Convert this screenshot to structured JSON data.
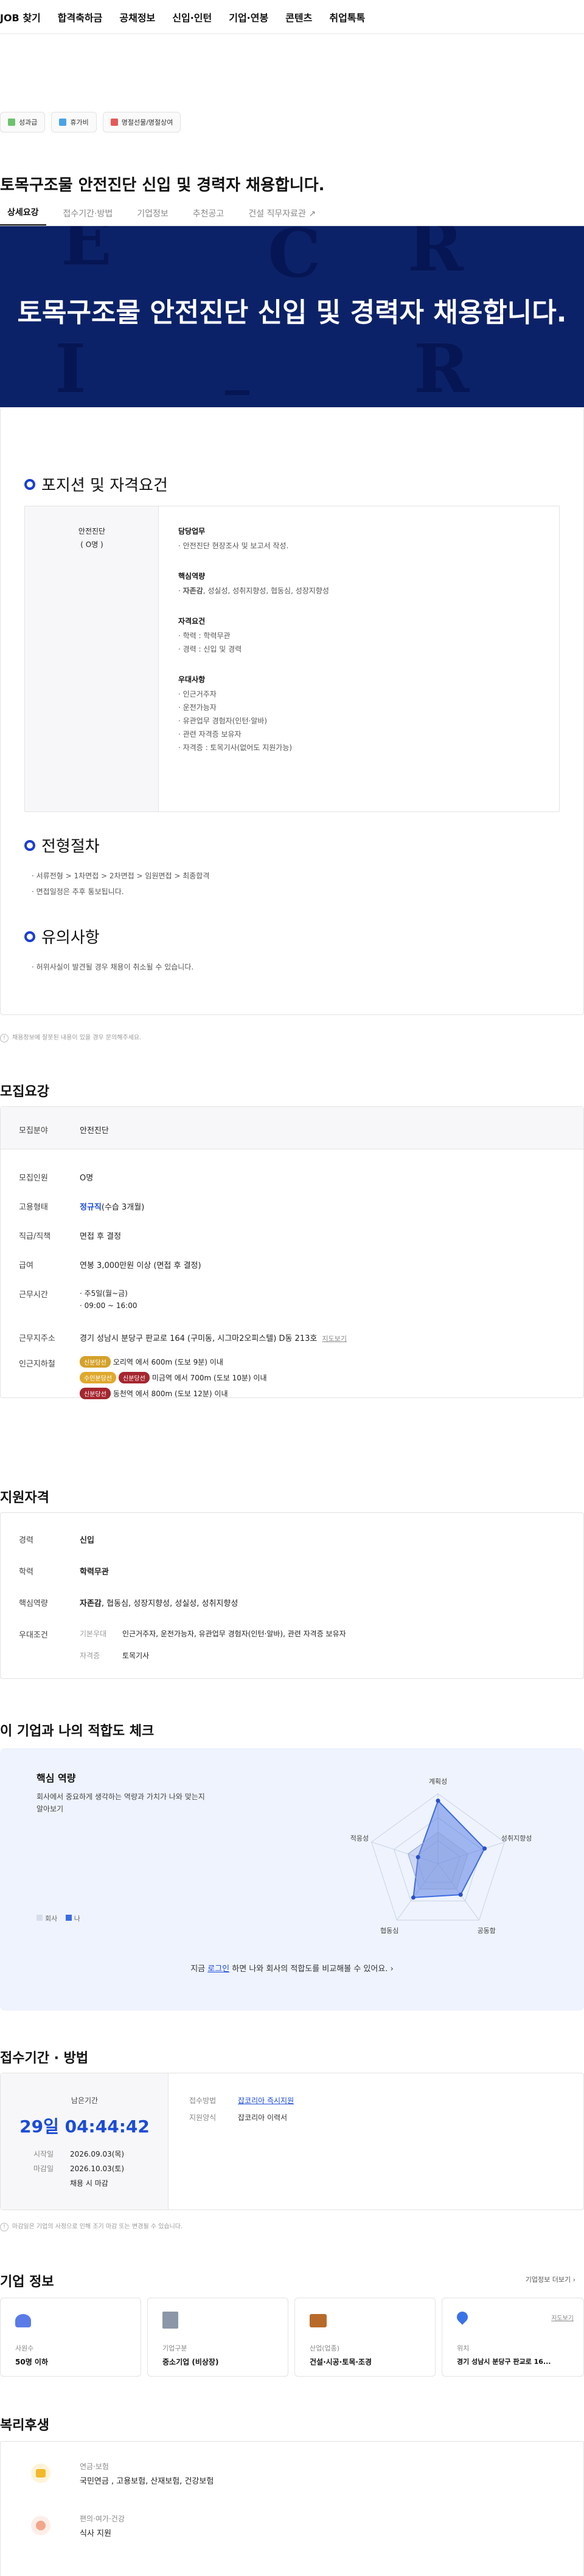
{
  "nav": [
    "JOB 찾기",
    "합격축하금",
    "공채정보",
    "신입·인턴",
    "기업·연봉",
    "콘텐츠",
    "취업톡톡"
  ],
  "badges": [
    "성과급",
    "휴가비",
    "명절선물/명절상여"
  ],
  "title": "토목구조물 안전진단 신입 및 경력자 채용합니다.",
  "tabs": [
    "상세요강",
    "접수기간·방법",
    "기업정보",
    "추천공고",
    "건설 직무자료관"
  ],
  "hero": {
    "title": "토목구조물 안전진단 신입 및 경력자 채용합니다.",
    "letters": [
      "E",
      "C",
      "R",
      "I",
      "U",
      "R"
    ]
  },
  "position": {
    "heading": "포지션 및 자격요건",
    "job_title": "안전진단",
    "headcount": "( O명 )",
    "duty_label": "담당업무",
    "duty": "· 안전진단 현장조사 및 보고서 작성.",
    "core_label": "핵심역량",
    "core_prefix": "· ",
    "core_bold": "자존감",
    "core_rest": ", 성실성, 성취지향성, 협동심, 성장지향성",
    "qual_label": "자격요건",
    "quals": [
      "· 학력 : 학력무관",
      "· 경력 : 신입 및 경력"
    ],
    "pref_label": "우대사항",
    "prefs": [
      "· 인근거주자",
      "· 운전가능자",
      "· 유관업무 경험자(인턴·알바)",
      "· 관련 자격증 보유자",
      "· 자격증 : 토목기사(없어도 지원가능)"
    ]
  },
  "process": {
    "heading": "전형절차",
    "steps": "· 서류전형 > 1차면접 > 2차면접 > 임원면접 > 최종합격",
    "note": "· 면접일정은 추후 통보됩니다."
  },
  "caution": {
    "heading": "유의사항",
    "text": "· 허위사실이 발견될 경우 채용이 취소될 수 있습니다."
  },
  "notice1": "채용정보에 잘못된 내용이 있을 경우 문의해주세요.",
  "summary": {
    "heading": "모집요강",
    "rows": [
      {
        "label": "모집분야",
        "value": "안전진단"
      },
      {
        "label": "모집인원",
        "value": "O명"
      },
      {
        "label": "고용형태",
        "value": "정규직",
        "extra": "(수습 3개월)"
      },
      {
        "label": "직급/직책",
        "value": "면접 후 결정"
      },
      {
        "label": "급여",
        "value": "연봉 3,000만원 이상 (면접 후 결정)"
      },
      {
        "label": "근무시간",
        "value": "· 주5일(월~금)",
        "value2": "· 09:00 ~ 16:00"
      },
      {
        "label": "근무지주소",
        "value": "경기 성남시 분당구 판교로 164 (구미동, 시그마2오피스텔) D동 213호",
        "link": "지도보기"
      },
      {
        "label": "인근지하철"
      }
    ],
    "subway": [
      {
        "line": "신분당선",
        "color": "#d4a12a",
        "text": "오리역 에서 600m (도보 9분) 이내"
      },
      {
        "line": "수인분당선",
        "color": "#e0a92d",
        "line2": "신분당선",
        "color2": "#a5262f",
        "text": "미금역 에서 700m (도보 10분) 이내"
      },
      {
        "line": "신분당선",
        "color": "#a5262f",
        "text": "동천역 에서 800m (도보 12분) 이내"
      }
    ]
  },
  "eligibility": {
    "heading": "지원자격",
    "career_label": "경력",
    "career": "신입",
    "edu_label": "학력",
    "edu": "학력무관",
    "core_label": "핵심역량",
    "core_bold": "자존감",
    "core_rest": ", 협동심, 성장지향성, 성실성, 성취지향성",
    "pref_label": "우대조건",
    "basic_label": "기본우대",
    "basic": "인근거주자, 운전가능자, 유관업무 경험자(인턴·알바), 관련 자격증 보유자",
    "cert_label": "자격증",
    "cert": "토목기사"
  },
  "fit": {
    "heading": "이 기업과 나의 적합도 체크",
    "sub": "핵심 역량",
    "desc": "회사에서 중요하게 생각하는 역량과 가치가 나와 맞는지 알아보기",
    "legend": [
      "회사",
      "나"
    ],
    "axes": [
      "계획성",
      "성취지향성",
      "공동함",
      "협동심",
      "적응성"
    ],
    "company": [
      0.9,
      0.7,
      0.55,
      0.6,
      0.3
    ],
    "me": [
      0.45,
      0.45,
      0.45,
      0.45,
      0.45
    ],
    "cta_pre": "지금 ",
    "cta_link": "로그인",
    "cta_post": " 하면 나와 회사의 적합도를 비교해볼 수 있어요."
  },
  "apply": {
    "heading": "접수기간 · 방법",
    "remain_label": "남은기간",
    "remain": "29일 04:44:42",
    "start_label": "시작일",
    "start": "2026.09.03(목)",
    "end_label": "마감일",
    "end": "2026.10.03(토)",
    "close_note": "채용 시 마감",
    "method_label": "접수방법",
    "method": "잡코리아 즉시지원",
    "form_label": "지원양식",
    "form": "잡코리아 이력서"
  },
  "notice2": "마감일은 기업의 사정으로 인해 조기 마감 또는 변경될 수 있습니다.",
  "company": {
    "heading": "기업 정보",
    "more": "기업정보 더보기",
    "cards": [
      {
        "label": "사원수",
        "value": "50명 이하",
        "icon": "people-icon",
        "color": "#5b7be8"
      },
      {
        "label": "기업구분",
        "value": "중소기업 (비상장)",
        "icon": "building-icon",
        "color": "#8b96a8"
      },
      {
        "label": "산업(업종)",
        "value": "건설·시공·토목·조경",
        "icon": "briefcase-icon",
        "color": "#b86a2a"
      },
      {
        "label": "위치",
        "value": "경기 성남시 분당구 판교로 16...",
        "icon": "pin-icon",
        "color": "#3a72e8",
        "link": "지도보기"
      }
    ]
  },
  "welfare": {
    "heading": "복리후생",
    "items": [
      {
        "category": "연금·보험",
        "value": "국민연금 , 고용보험, 산재보험, 건강보험",
        "icon": "coin-icon"
      },
      {
        "category": "편의·여가·건강",
        "value": "식사 지원",
        "icon": "arm-icon"
      }
    ]
  }
}
